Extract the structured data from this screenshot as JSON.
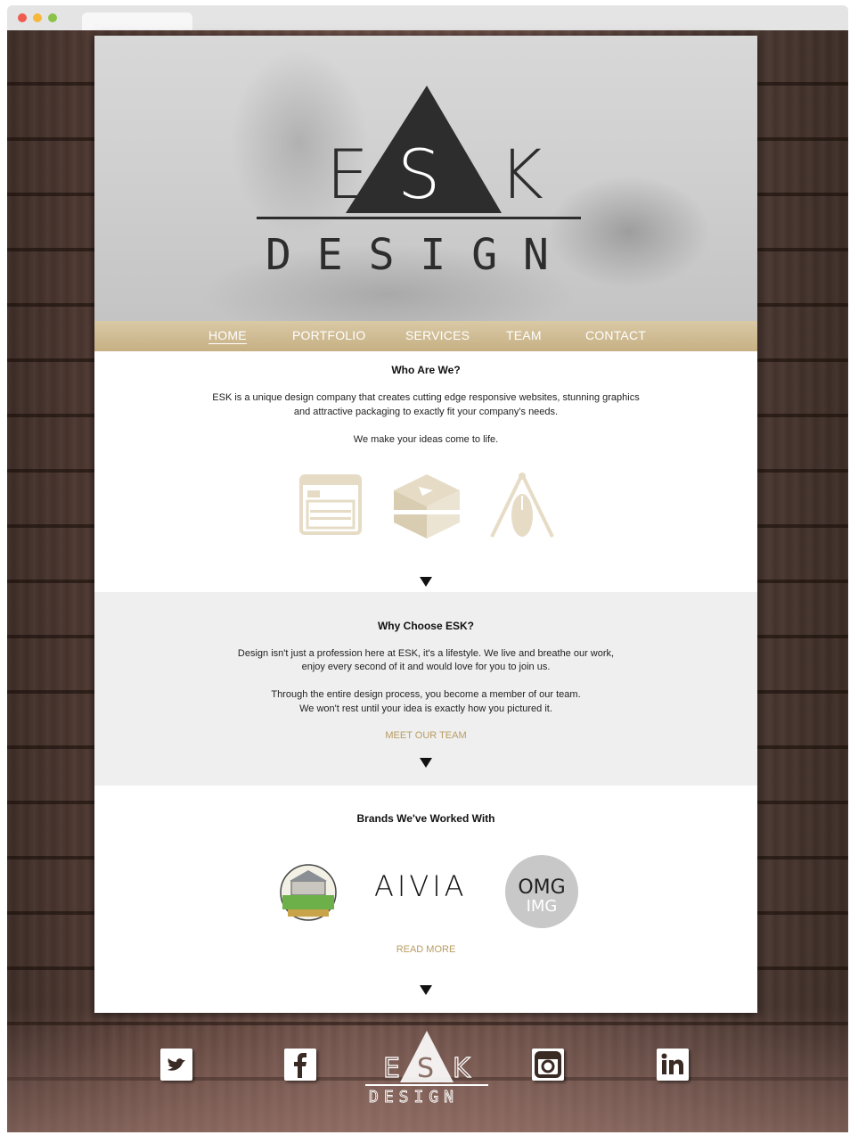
{
  "browser": {
    "window_controls": [
      "close",
      "minimize",
      "maximize"
    ]
  },
  "hero": {
    "logo_letters": [
      "E",
      "S",
      "K"
    ],
    "logo_word": "D E S I G N"
  },
  "nav": {
    "items": [
      {
        "label": "HOME",
        "active": true
      },
      {
        "label": "PORTFOLIO",
        "active": false
      },
      {
        "label": "SERVICES",
        "active": false
      },
      {
        "label": "TEAM",
        "active": false
      },
      {
        "label": "CONTACT",
        "active": false
      }
    ]
  },
  "who": {
    "title": "Who Are We?",
    "line1": "ESK is a unique design company that creates cutting edge responsive websites, stunning graphics",
    "line2": "and attractive packaging to exactly fit your company's needs.",
    "line3": "We make your ideas come to life.",
    "icons": [
      "web-layout-icon",
      "package-box-icon",
      "design-tools-icon"
    ]
  },
  "why": {
    "title": "Why Choose ESK?",
    "line1": "Design isn't just a profession here at ESK, it's a lifestyle. We live and breathe our work,",
    "line2": "enjoy every second of it and would love for you to join us.",
    "line3": "Through the entire design process, you become a member of our team.",
    "line4": "We won't rest until your idea is exactly how you pictured it.",
    "link": "MEET OUR TEAM"
  },
  "brands": {
    "title": "Brands We've Worked With",
    "logos": [
      {
        "name": "farm-brand-logo"
      },
      {
        "name": "aivia-logo",
        "text": "AIVIA"
      },
      {
        "name": "omg-img-logo",
        "text1": "OMG",
        "text2": "IMG"
      }
    ],
    "link": "READ MORE"
  },
  "footer": {
    "social": [
      "twitter-icon",
      "facebook-icon",
      "instagram-icon",
      "linkedin-icon"
    ],
    "logo_letters": [
      "E",
      "S",
      "K"
    ],
    "logo_word": "DESIGN"
  },
  "colors": {
    "accent": "#c7b083",
    "link": "#b89c62",
    "icon_tint": "#e6dcc6",
    "gray_section": "#efefef"
  }
}
